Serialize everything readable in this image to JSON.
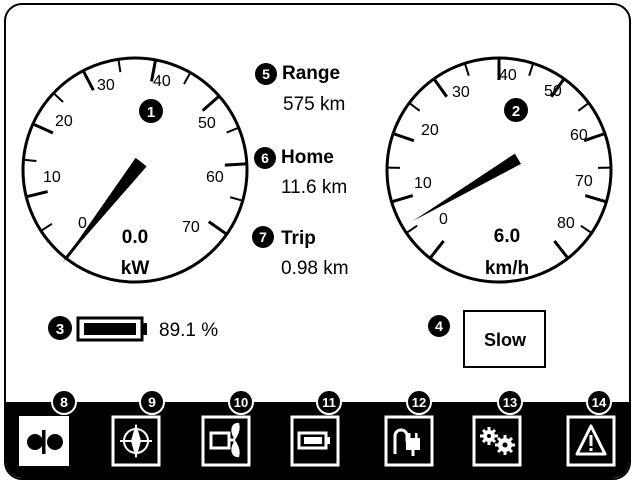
{
  "colors": {
    "foreground": "#000000",
    "background": "#ffffff"
  },
  "power_gauge": {
    "marker": "1",
    "tick_labels": [
      "0",
      "10",
      "20",
      "30",
      "40",
      "50",
      "60",
      "70"
    ],
    "value": "0.0",
    "unit": "kW",
    "needle_value": 0.0
  },
  "speed_gauge": {
    "marker": "2",
    "tick_labels": [
      "0",
      "10",
      "20",
      "30",
      "40",
      "50",
      "60",
      "70",
      "80"
    ],
    "value": "6.0",
    "unit": "km/h",
    "needle_value": 6.0
  },
  "info": {
    "range": {
      "marker": "5",
      "label": "Range",
      "value": "575 km"
    },
    "home": {
      "marker": "6",
      "label": "Home",
      "value": "11.6 km"
    },
    "trip": {
      "marker": "7",
      "label": "Trip",
      "value": "0.98 km"
    }
  },
  "battery": {
    "marker": "3",
    "text": "89.1 %",
    "icon": "battery-icon"
  },
  "mode_button": {
    "marker": "4",
    "label": "Slow"
  },
  "toolbar": [
    {
      "marker": "8",
      "icon": "gauges-icon",
      "selected": true
    },
    {
      "marker": "9",
      "icon": "compass-icon",
      "selected": false
    },
    {
      "marker": "10",
      "icon": "propeller-motor-icon",
      "selected": false
    },
    {
      "marker": "11",
      "icon": "battery-icon",
      "selected": false
    },
    {
      "marker": "12",
      "icon": "charging-plug-icon",
      "selected": false
    },
    {
      "marker": "13",
      "icon": "settings-gears-icon",
      "selected": false
    },
    {
      "marker": "14",
      "icon": "warning-icon",
      "selected": false
    }
  ]
}
